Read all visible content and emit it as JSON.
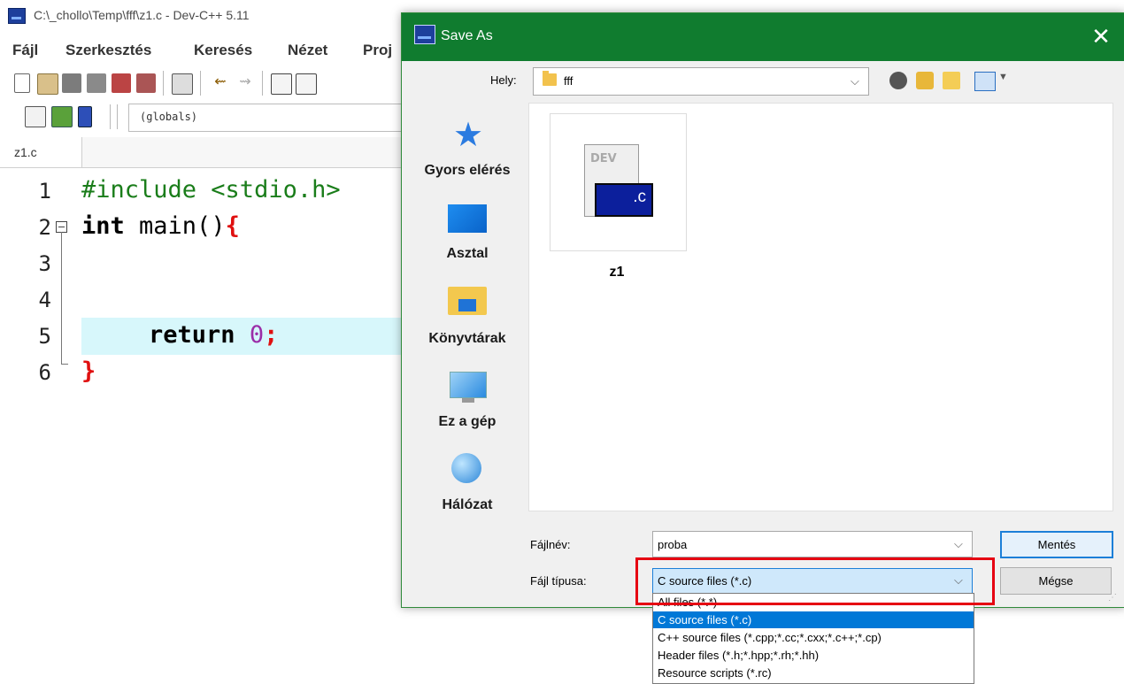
{
  "ide": {
    "window_title": "C:\\_chollo\\Temp\\fff\\z1.c - Dev-C++ 5.11",
    "menu": [
      "Fájl",
      "Szerkesztés",
      "Keresés",
      "Nézet",
      "Proj"
    ],
    "globals_combo": "(globals)",
    "tab": "z1.c",
    "line_numbers": [
      "1",
      "2",
      "3",
      "4",
      "5",
      "6"
    ],
    "code": {
      "line1": "#include <stdio.h>",
      "line2_kw": "int",
      "line2_rest": " main()",
      "line2_brace": "{",
      "line5_kw": "return",
      "line5_num": "0",
      "line5_semi": ";",
      "line6": "}"
    }
  },
  "dialog": {
    "title": "Save As",
    "close_glyph": "✕",
    "location_label": "Hely:",
    "location_value": "fff",
    "places": [
      "Gyors elérés",
      "Asztal",
      "Könyvtárak",
      "Ez a gép",
      "Hálózat"
    ],
    "files": [
      {
        "name": "z1",
        "badge": ".c",
        "doc_text": "DEV"
      }
    ],
    "filename_label": "Fájlnév:",
    "filename_value": "proba",
    "filetype_label": "Fájl típusa:",
    "filetype_value": "C source files (*.c)",
    "save_button": "Mentés",
    "cancel_button": "Mégse",
    "filetype_options": [
      "All files (*.*)",
      "C source files (*.c)",
      "C++ source files (*.cpp;*.cc;*.cxx;*.c++;*.cp)",
      "Header files (*.h;*.hpp;*.rh;*.hh)",
      "Resource scripts (*.rc)"
    ],
    "selected_option_index": 1
  },
  "colors": {
    "dialog_titlebar": "#107c2f",
    "annotation": "#e60012",
    "selection": "#0078d7",
    "code_keyword": "#000000",
    "code_preprocessor": "#1a7d1a",
    "code_number": "#9b2ea8",
    "code_brace": "#e01010"
  }
}
